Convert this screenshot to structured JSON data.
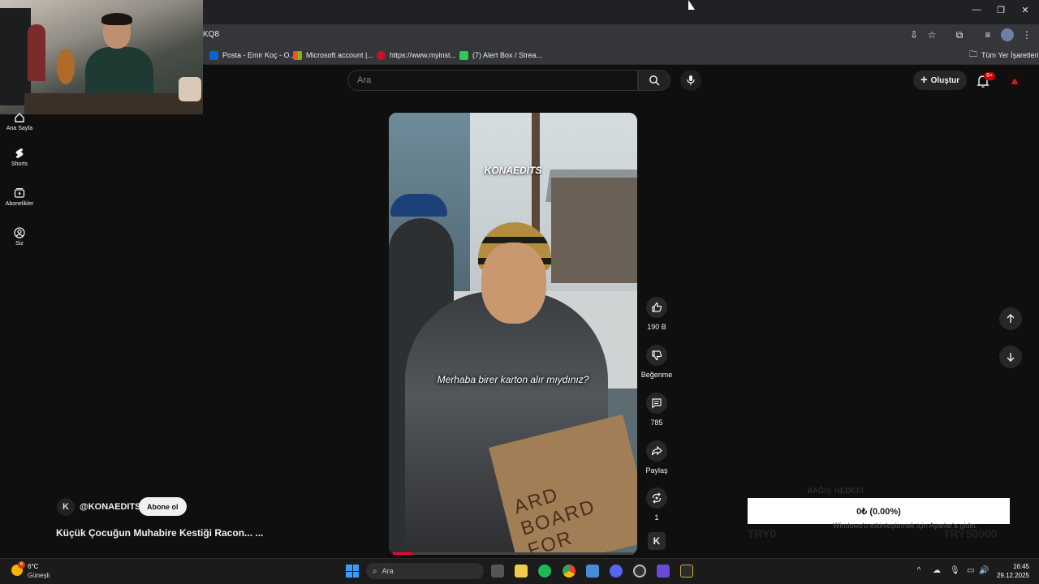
{
  "browser": {
    "url_fragment": "KQ8",
    "bookmarks": [
      {
        "label": "Posta - Emir Koç - O...",
        "color": "#0a64d6"
      },
      {
        "label": "Microsoft account |...",
        "color": "#f25022"
      },
      {
        "label": "https://www.myinst...",
        "color": "#c8102e"
      },
      {
        "label": "(7) Alert Box / Strea...",
        "color": "#34c759"
      }
    ],
    "all_bookmarks": "Tüm Yer İşaretleri"
  },
  "sidebar": {
    "items": [
      {
        "label": "Ana Sayfa",
        "icon": "home-icon"
      },
      {
        "label": "Shorts",
        "icon": "shorts-icon"
      },
      {
        "label": "Abonelikler",
        "icon": "subscriptions-icon"
      },
      {
        "label": "Siz",
        "icon": "account-icon"
      }
    ]
  },
  "header": {
    "search_placeholder": "Ara",
    "create_label": "Oluştur",
    "notifications_badge": "9+"
  },
  "video": {
    "watermark": "KONAEDITS",
    "caption": "Merhaba birer karton alır mıydınız?",
    "board_text": "ARD BOARD FOR",
    "progress": 0.08
  },
  "actions": {
    "like_count": "190 B",
    "dislike_label": "Beğenme",
    "comment_count": "785",
    "share_label": "Paylaş",
    "remix_count": "1"
  },
  "channel": {
    "handle": "@KONAEDITS",
    "subscribe_label": "Abone ol",
    "video_title": "Küçük Çocuğun Muhabire Kestiği Racon... ..."
  },
  "donation": {
    "amount": "0₺ (0.00%)",
    "goal_label": "BAĞIŞ HEDEFİ",
    "min": "TRY0",
    "max": "TRY50000",
    "activation": "Windows'u etkinleştirmek için Ayarlar'a gidin."
  },
  "taskbar": {
    "temperature": "6°C",
    "condition": "Güneşli",
    "weather_badge": "6",
    "search_placeholder": "Ara",
    "time": "16:45",
    "date": "29.12.2025"
  },
  "colors": {
    "accent": "#ff0033",
    "background": "#0f0f0f",
    "notification": "#cc0000"
  }
}
